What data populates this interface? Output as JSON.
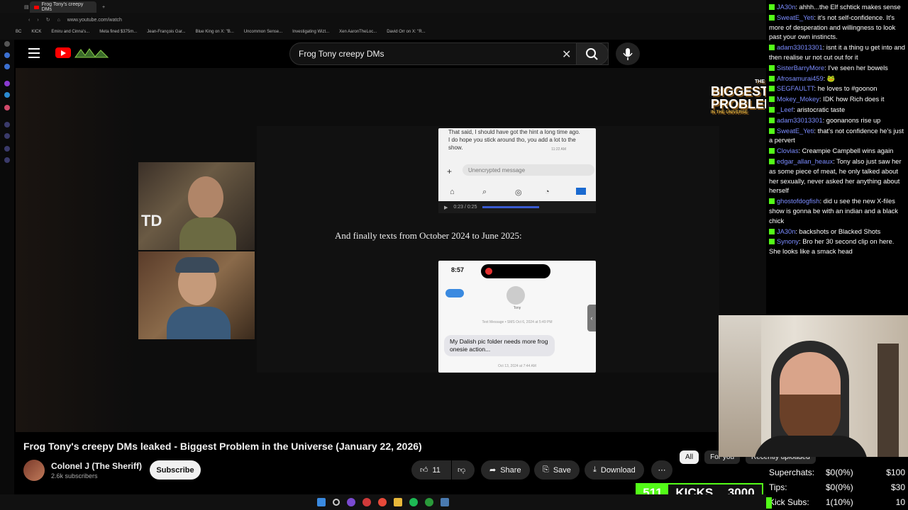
{
  "browser": {
    "active_tab": "Frog Tony's creepy DMs",
    "address": "www.youtube.com/watch",
    "bookmarks": [
      "BC",
      "KICK",
      "Emiru and Cinna's...",
      "Meta fined $375m...",
      "Jean-François Gar...",
      "Blue King on X: \"B...",
      "Uncommon Sense...",
      "Investigating Wizt...",
      "Xen AaronTheLoc...",
      "David Orr on X: \"R..."
    ]
  },
  "youtube": {
    "search_query": "Frog Tony creepy DMs",
    "video_title": "Frog Tony's creepy DMs leaked - Biggest Problem in the Universe (January 22, 2026)",
    "channel_name": "Colonel J (The Sheriff)",
    "channel_subs": "2.6k subscribers",
    "subscribe_label": "Subscribe",
    "like_count": "11",
    "share_label": "Share",
    "save_label": "Save",
    "download_label": "Download",
    "more_label": "⋯",
    "chips": [
      "All",
      "For you",
      "Recently uploaded"
    ]
  },
  "video_frame": {
    "caption": "And finally texts from October 2024 to June 2025:",
    "phone1_text": "That said, I should have got the hint a long time ago. I do hope you stick around tho, you add a lot to the show.",
    "phone1_time": "11:22 AM",
    "phone1_placeholder": "Unencrypted message",
    "phone1_player_time": "0:23 / 0:25",
    "phone2_clock": "8:57",
    "phone2_contact": "Tony",
    "phone2_header": "Text Message • SMS Oct 6, 2024 at 5:49 PM",
    "phone2_bubble": "My Dalish pic folder needs more frog onesie action...",
    "phone2_footer": "Oct 13, 2024 at 7:44 AM",
    "logo_line1": "THE",
    "logo_line2": "BIGGEST",
    "logo_line3": "PROBLEM",
    "logo_line4": "IN THE UNIVERSE"
  },
  "chat": [
    {
      "user": "JA30n",
      "text": "ahhh...the Elf schtick makes sense"
    },
    {
      "user": "SweatE_Yeti",
      "text": "it's not self-confidence. It's more of desperation and willingness to look past your own instincts."
    },
    {
      "user": "adam33013301",
      "text": "isnt it a thing u get into and then realise ur not cut out for it"
    },
    {
      "user": "SisterBarryMore",
      "text": "I've seen her bowels"
    },
    {
      "user": "Afrosamurai459",
      "text": "🐸"
    },
    {
      "user": "SEGFAULTT",
      "text": "he loves to #goonon"
    },
    {
      "user": "Mokey_Mokey",
      "text": "IDK how Rich does it"
    },
    {
      "user": "_Leef",
      "text": "aristocratic taste"
    },
    {
      "user": "adam33013301",
      "text": "goonanons rise up"
    },
    {
      "user": "SweatE_Yeti",
      "text": "that's not confidence he's just a pervert"
    },
    {
      "user": "Clovias",
      "text": "Creampie Campbell wins again"
    },
    {
      "user": "edgar_allan_heaux",
      "text": "Tony also just saw her as some piece of meat, he only talked about her sexually, never asked her anything about herself"
    },
    {
      "user": "ghostofdogfish",
      "text": "did u see the new X-files show is gonna be with an indian and a black chick"
    },
    {
      "user": "JA30n",
      "text": "backshots or Blacked Shots"
    },
    {
      "user": "Synony",
      "text": "Bro her 30 second clip on here. She looks like a smack head"
    }
  ],
  "kicks": {
    "count": "511",
    "label": "KICKS",
    "goal": "3000"
  },
  "stats": [
    {
      "label": "Superchats:",
      "value": "$0(0%)",
      "goal": "$100"
    },
    {
      "label": "Tips:",
      "value": "$0(0%)",
      "goal": "$30"
    },
    {
      "label": "Kick Subs:",
      "value": "1(10%)",
      "goal": "10"
    }
  ],
  "colors": {
    "kick_green": "#53fc18",
    "yt_red": "#ff0000",
    "chat_user": "#7b8cff"
  }
}
